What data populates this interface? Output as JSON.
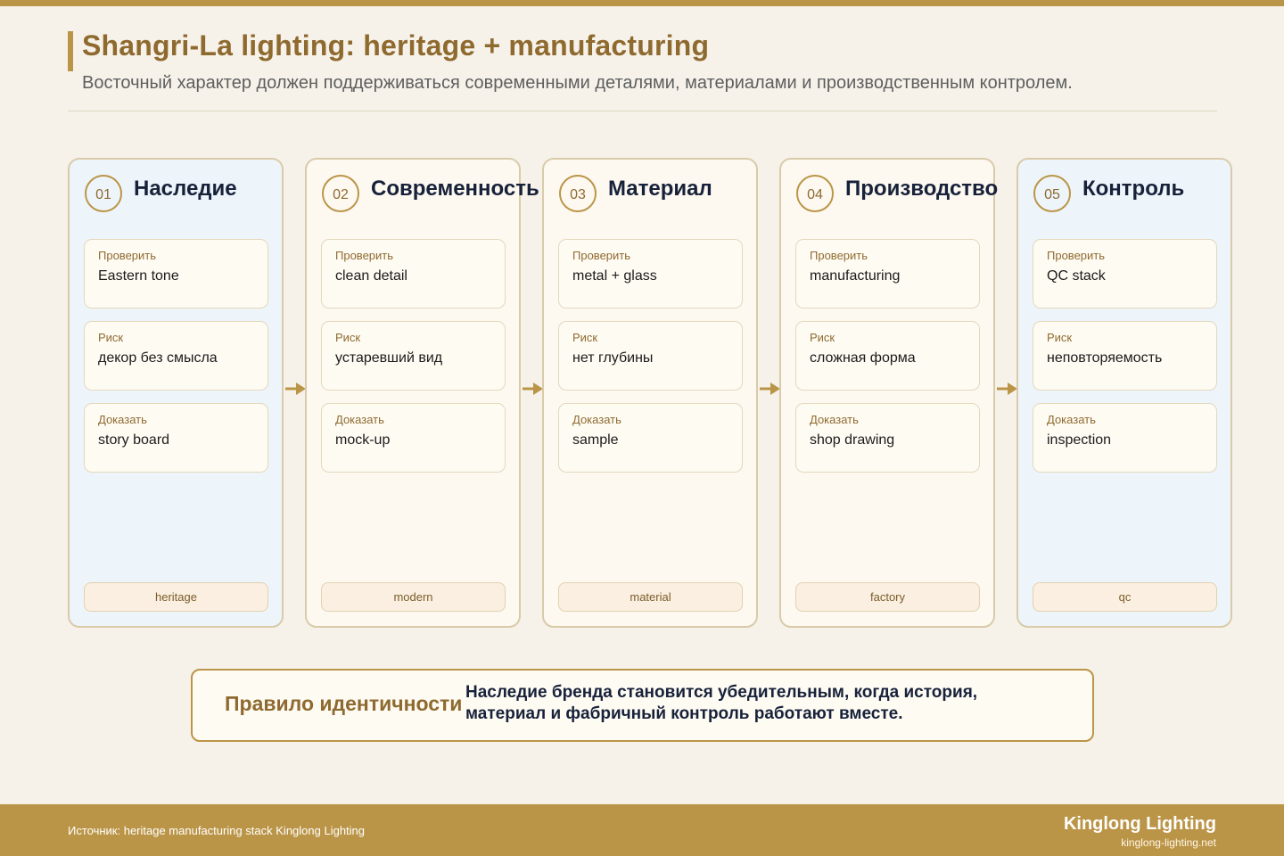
{
  "header": {
    "title": "Shangri-La lighting: heritage + manufacturing",
    "subtitle": "Восточный характер должен поддерживаться современными деталями, материалами и производственным контролем."
  },
  "stages": [
    {
      "num": "01",
      "title": "Наследие",
      "check_label": "Проверить",
      "check": "Eastern tone",
      "risk_label": "Риск",
      "risk": "декор без смысла",
      "prove_label": "Доказать",
      "prove": "story board",
      "tag": "heritage"
    },
    {
      "num": "02",
      "title": "Современность",
      "check_label": "Проверить",
      "check": "clean detail",
      "risk_label": "Риск",
      "risk": "устаревший вид",
      "prove_label": "Доказать",
      "prove": "mock-up",
      "tag": "modern"
    },
    {
      "num": "03",
      "title": "Материал",
      "check_label": "Проверить",
      "check": "metal + glass",
      "risk_label": "Риск",
      "risk": "нет глубины",
      "prove_label": "Доказать",
      "prove": "sample",
      "tag": "material"
    },
    {
      "num": "04",
      "title": "Производство",
      "check_label": "Проверить",
      "check": "manufacturing",
      "risk_label": "Риск",
      "risk": "сложная форма",
      "prove_label": "Доказать",
      "prove": "shop drawing",
      "tag": "factory"
    },
    {
      "num": "05",
      "title": "Контроль",
      "check_label": "Проверить",
      "check": "QC stack",
      "risk_label": "Риск",
      "risk": "неповторяемость",
      "prove_label": "Доказать",
      "prove": "inspection",
      "tag": "qc"
    }
  ],
  "rule": {
    "title": "Правило идентичности",
    "text": "Наследие бренда становится убедительным, когда история, материал и фабричный контроль работают вместе."
  },
  "footer": {
    "source": "Источник: heritage manufacturing stack Kinglong Lighting",
    "brand": "Kinglong Lighting",
    "url": "kinglong-lighting.net"
  },
  "colors": {
    "accent": "#bb9547",
    "accent_text": "#8f6a2f",
    "heading": "#17213a",
    "blue_panel": "#edf5fb",
    "cream_panel": "#fdf9f1",
    "background": "#f6f2ea"
  },
  "icons": [
    "arrow-right-icon"
  ]
}
